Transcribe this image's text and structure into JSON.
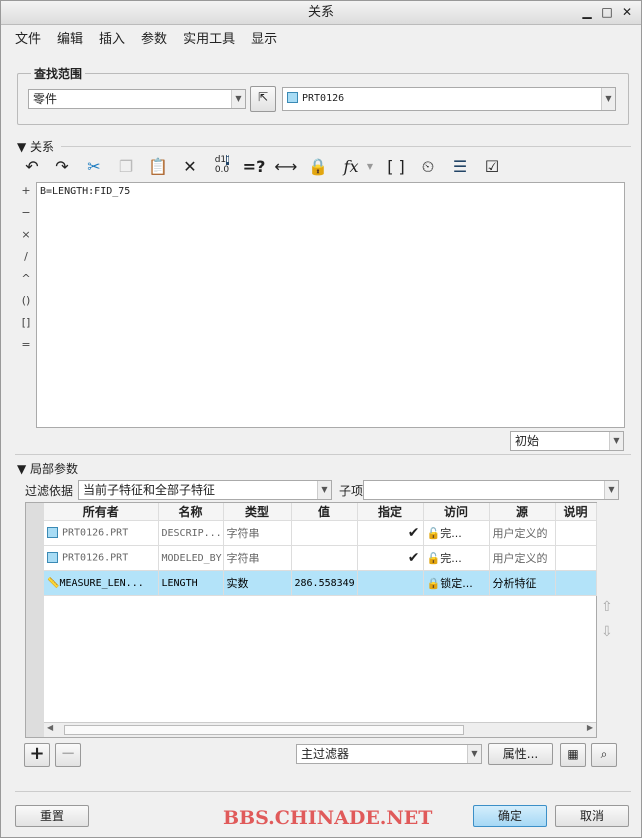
{
  "window": {
    "title": "关系"
  },
  "menu": [
    "文件",
    "编辑",
    "插入",
    "参数",
    "实用工具",
    "显示"
  ],
  "lookup": {
    "label": "查找范围",
    "type_value": "零件",
    "object_value": "PRT0126"
  },
  "relations": {
    "label": "关系",
    "text": "B=LENGTH:FID_75",
    "side_ops": [
      "+",
      "−",
      "×",
      "/",
      "^",
      "()",
      "[]",
      "="
    ],
    "state_value": "初始"
  },
  "local_params": {
    "label": "局部参数",
    "filter_label": "过滤依据",
    "filter_value": "当前子特征和全部子特征",
    "sub_label": "子项",
    "sub_value": "",
    "columns": [
      "所有者",
      "名称",
      "类型",
      "值",
      "指定",
      "访问",
      "源",
      "说明"
    ],
    "rows": [
      {
        "owner": "PRT0126.PRT",
        "name": "DESCRIP...",
        "type": "字符串",
        "value": "",
        "designated": "✔",
        "access": "完...",
        "source": "用户定义的",
        "desc": ""
      },
      {
        "owner": "PRT0126.PRT",
        "name": "MODELED_BY",
        "type": "字符串",
        "value": "",
        "designated": "✔",
        "access": "完...",
        "source": "用户定义的",
        "desc": ""
      },
      {
        "owner": "MEASURE_LEN...",
        "name": "LENGTH",
        "type": "实数",
        "value": "286.558349",
        "designated": "",
        "access": "锁定...",
        "source": "分析特征",
        "desc": ""
      }
    ],
    "main_filter": "主过滤器",
    "properties_button": "属性..."
  },
  "buttons": {
    "reset": "重置",
    "ok": "确定",
    "cancel": "取消"
  },
  "watermark": "BBS.CHINADE.NET"
}
